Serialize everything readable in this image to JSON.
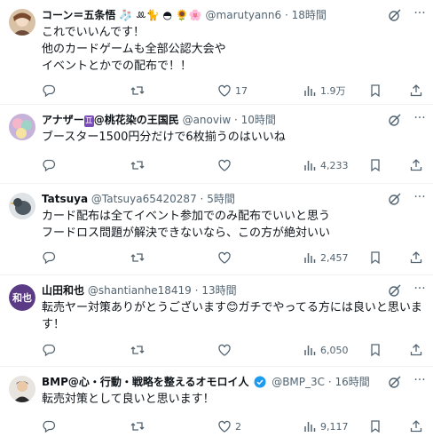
{
  "tweets": [
    {
      "name": "コーン＝五条悟",
      "name_emoji": "🧦 ꔛ🐈 ◓ 🌻🌸",
      "handle": "@marutyann6",
      "time": "18時間",
      "lines": [
        "これでいいんです！",
        "他のカードゲームも全部公認大会や",
        "イベントとかでの配布で！！"
      ],
      "likes": "17",
      "views": "1.9万",
      "retweets": ""
    },
    {
      "name": "アナザー",
      "name_badge": "♊",
      "name_rest": "@桃花染の王国民",
      "handle": "@anoviw",
      "time": "10時間",
      "lines": [
        "ブースター1500円分だけで6枚揃うのはいいね"
      ],
      "likes": "",
      "views": "4,233"
    },
    {
      "name": "Tatsuya",
      "handle": "@Tatsuya65420287",
      "time": "5時間",
      "lines": [
        "カード配布は全てイベント参加でのみ配布でいいと思う",
        "フードロス問題が解決できないなら、この方が絶対いい"
      ],
      "likes": "",
      "views": "2,457"
    },
    {
      "name": "山田和也",
      "avatar_text": "和也",
      "handle": "@shantianhe18419",
      "time": "13時間",
      "lines": [
        "転売ヤー対策ありがとうございます😊ガチでやってる方には良いと思いま",
        "す！"
      ],
      "likes": "",
      "views": "6,050"
    },
    {
      "name": "BMP@心・行動・戦略を整えるオモロイ人",
      "handle": "@BMP_3C",
      "time": "16時間",
      "lines": [
        "転売対策として良いと思います！"
      ],
      "likes": "2",
      "views": "9,117"
    }
  ],
  "separator": "·",
  "more_glyph": "···",
  "colors": {
    "text": "#0f1419",
    "secondary": "#536471",
    "verified": "#1d9bf0",
    "divider": "#eff3f4"
  },
  "icons": [
    "reply-icon",
    "retweet-icon",
    "like-icon",
    "views-icon",
    "bookmark-icon",
    "share-icon",
    "grok-icon",
    "more-icon",
    "verified-badge-icon"
  ]
}
